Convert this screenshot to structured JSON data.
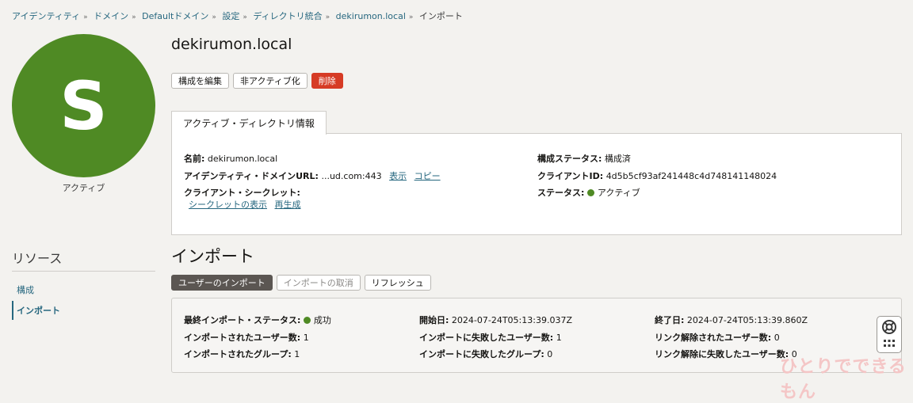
{
  "breadcrumb": {
    "items": [
      "アイデンティティ",
      "ドメイン",
      "Defaultドメイン",
      "設定",
      "ディレクトリ統合",
      "dekirumon.local"
    ],
    "current": "インポート",
    "separator": "»"
  },
  "avatar": {
    "initial": "S",
    "status": "アクティブ"
  },
  "page_title": "dekirumon.local",
  "actions": {
    "edit": "構成を編集",
    "deactivate": "非アクティブ化",
    "delete": "削除"
  },
  "info_tab": "アクティブ・ディレクトリ情報",
  "info": {
    "name_label": "名前:",
    "name_value": "dekirumon.local",
    "url_label": "アイデンティティ・ドメインURL:",
    "url_value": "...ud.com:443",
    "url_show": "表示",
    "url_copy": "コピー",
    "secret_label": "クライアント・シークレット:",
    "secret_show": "シークレットの表示",
    "secret_regen": "再生成",
    "config_status_label": "構成ステータス:",
    "config_status_value": "構成済",
    "client_id_label": "クライアントID:",
    "client_id_value": "4d5b5cf93af241448c4d748141148024",
    "status_label": "ステータス:",
    "status_value": "アクティブ"
  },
  "resources": {
    "heading": "リソース",
    "items": [
      "構成",
      "インポート"
    ]
  },
  "import_section": {
    "title": "インポート",
    "buttons": {
      "import_users": "ユーザーのインポート",
      "cancel_import": "インポートの取消",
      "refresh": "リフレッシュ"
    }
  },
  "import_stats": {
    "last_status_label": "最終インポート・ステータス:",
    "last_status_value": "成功",
    "imported_users_label": "インポートされたユーザー数:",
    "imported_users_value": "1",
    "imported_groups_label": "インポートされたグループ:",
    "imported_groups_value": "1",
    "start_label": "開始日:",
    "start_value": "2024-07-24T05:13:39.037Z",
    "failed_users_label": "インポートに失敗したユーザー数:",
    "failed_users_value": "1",
    "failed_groups_label": "インポートに失敗したグループ:",
    "failed_groups_value": "0",
    "end_label": "終了日:",
    "end_value": "2024-07-24T05:13:39.860Z",
    "unlinked_users_label": "リンク解除されたユーザー数:",
    "unlinked_users_value": "0",
    "unlink_failed_label": "リンク解除に失敗したユーザー数:",
    "unlink_failed_value": "0"
  },
  "icons": {
    "help": "lifebuoy-icon",
    "apps": "grid-icon"
  },
  "colors": {
    "accent_green": "#4f8a24",
    "danger": "#d63b25",
    "link": "#26677f"
  },
  "watermark": "ひとりでできるもん"
}
